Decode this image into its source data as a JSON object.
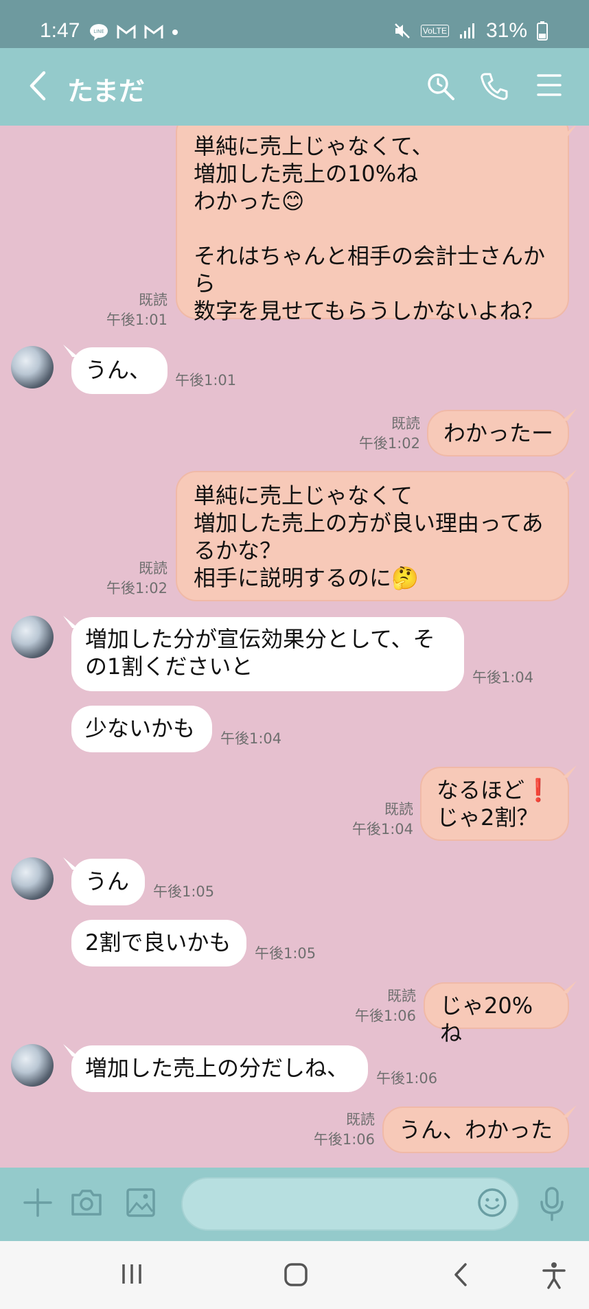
{
  "status_bar": {
    "time": "1:47",
    "battery": "31%",
    "volte": "VoLTE"
  },
  "header": {
    "title": "たまだ"
  },
  "messages": [
    {
      "side": "sent",
      "text": "単純に売上じゃなくて、\n増加した売上の10%ね\nわかった😊\n\nそれはちゃんと相手の会計士さんから\n数字を見せてもらうしかないよね？",
      "read": "既読",
      "time": "午後1:01"
    },
    {
      "side": "recv",
      "text": "うん、",
      "time": "午後1:01"
    },
    {
      "side": "sent",
      "text": "わかったー",
      "read": "既読",
      "time": "午後1:02"
    },
    {
      "side": "sent",
      "text": "単純に売上じゃなくて\n増加した売上の方が良い理由ってあるかな？\n相手に説明するのに🤔",
      "read": "既読",
      "time": "午後1:02"
    },
    {
      "side": "recv",
      "text": "増加した分が宣伝効果分として、その1割くださいと",
      "time": "午後1:04"
    },
    {
      "side": "recv",
      "text": "少ないかも",
      "time": "午後1:04"
    },
    {
      "side": "sent",
      "text": "なるほど❗\nじゃ2割？",
      "read": "既読",
      "time": "午後1:04"
    },
    {
      "side": "recv",
      "text": "うん",
      "time": "午後1:05"
    },
    {
      "side": "recv",
      "text": "2割で良いかも",
      "time": "午後1:05"
    },
    {
      "side": "sent",
      "text": "じゃ20%ね",
      "read": "既読",
      "time": "午後1:06"
    },
    {
      "side": "recv",
      "text": "増加した売上の分だしね、",
      "time": "午後1:06"
    },
    {
      "side": "sent",
      "text": "うん、わかった",
      "read": "既読",
      "time": "午後1:06"
    }
  ],
  "icons": {
    "header": [
      "back-icon",
      "search-icon",
      "phone-icon",
      "menu-icon"
    ],
    "input_bar": [
      "plus-icon",
      "camera-icon",
      "image-icon",
      "emoji-icon",
      "mic-icon"
    ],
    "nav_bar": [
      "recent-apps-icon",
      "home-icon",
      "nav-back-icon",
      "accessibility-icon"
    ]
  },
  "colors": {
    "chat_background": "#e6c0cf",
    "header": "#94cacb",
    "status_bar": "#6e9a9f",
    "sent_bubble": "#f7c9b8",
    "received_bubble": "#ffffff"
  }
}
